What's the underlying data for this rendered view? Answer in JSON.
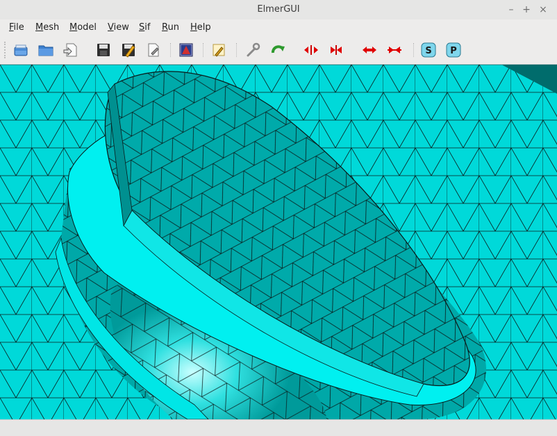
{
  "window": {
    "title": "ElmerGUI",
    "controls": [
      "–",
      "+",
      "×"
    ]
  },
  "menubar": {
    "items": [
      {
        "label": "File",
        "mnemonic": "F",
        "rest": "ile"
      },
      {
        "label": "Mesh",
        "mnemonic": "M",
        "rest": "esh"
      },
      {
        "label": "Model",
        "mnemonic": "M",
        "rest": "odel"
      },
      {
        "label": "View",
        "mnemonic": "V",
        "rest": "iew"
      },
      {
        "label": "Sif",
        "mnemonic": "S",
        "rest": "if"
      },
      {
        "label": "Run",
        "mnemonic": "R",
        "rest": "un"
      },
      {
        "label": "Help",
        "mnemonic": "H",
        "rest": "elp"
      }
    ]
  },
  "toolbar": {
    "icons": [
      "open-icon",
      "folder-icon",
      "load-project-icon",
      "save-icon",
      "save-as-icon",
      "edit-sif-icon",
      "generate-mesh-icon",
      "edit-icon",
      "settings-wrench-icon",
      "redo-icon",
      "unify-surface-icon",
      "unify-edge-icon",
      "divide-surface-icon",
      "divide-edge-icon",
      "solver-s-icon",
      "postprocessor-p-icon"
    ],
    "solver_letter": "S",
    "post_letter": "P"
  },
  "colors": {
    "mesh_bright": "#00f0f0",
    "mesh_mid": "#00c8c8",
    "mesh_dark": "#009a9a",
    "edge": "#0a1a1a",
    "corner": "#006c6c"
  },
  "statusbar": {
    "text": ""
  }
}
